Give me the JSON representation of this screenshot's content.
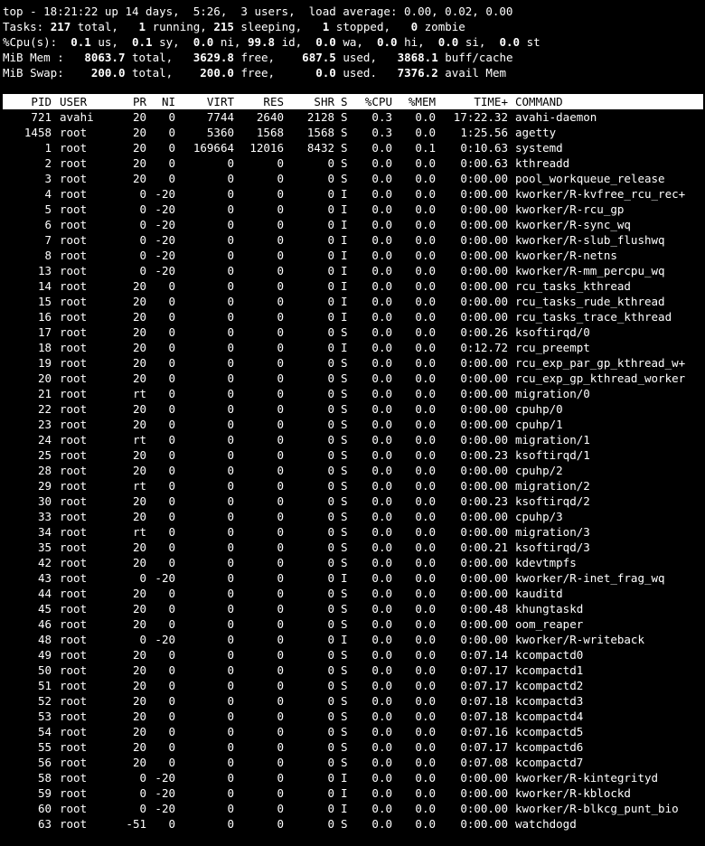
{
  "summary": {
    "line1": {
      "prefix": "top - 18:21:22 up 14 days,  5:26,  3 users,  load average: 0.00, 0.02, 0.00"
    },
    "tasks": [
      {
        "t": "Tasks: ",
        "b": false
      },
      {
        "t": "217",
        "b": true
      },
      {
        "t": " total,   ",
        "b": false
      },
      {
        "t": "1",
        "b": true
      },
      {
        "t": " running, ",
        "b": false
      },
      {
        "t": "215",
        "b": true
      },
      {
        "t": " sleeping,   ",
        "b": false
      },
      {
        "t": "1",
        "b": true
      },
      {
        "t": " stopped,   ",
        "b": false
      },
      {
        "t": "0",
        "b": true
      },
      {
        "t": " zombie",
        "b": false
      }
    ],
    "cpu": [
      {
        "t": "%Cpu(s): ",
        "b": false
      },
      {
        "t": " 0.1",
        "b": true
      },
      {
        "t": " us, ",
        "b": false
      },
      {
        "t": " 0.1",
        "b": true
      },
      {
        "t": " sy, ",
        "b": false
      },
      {
        "t": " 0.0",
        "b": true
      },
      {
        "t": " ni, ",
        "b": false
      },
      {
        "t": "99.8",
        "b": true
      },
      {
        "t": " id, ",
        "b": false
      },
      {
        "t": " 0.0",
        "b": true
      },
      {
        "t": " wa, ",
        "b": false
      },
      {
        "t": " 0.0",
        "b": true
      },
      {
        "t": " hi, ",
        "b": false
      },
      {
        "t": " 0.0",
        "b": true
      },
      {
        "t": " si, ",
        "b": false
      },
      {
        "t": " 0.0",
        "b": true
      },
      {
        "t": " st",
        "b": false
      }
    ],
    "mem": [
      {
        "t": "MiB Mem : ",
        "b": false
      },
      {
        "t": "  8063.7",
        "b": true
      },
      {
        "t": " total, ",
        "b": false
      },
      {
        "t": "  3629.8",
        "b": true
      },
      {
        "t": " free, ",
        "b": false
      },
      {
        "t": "   687.5",
        "b": true
      },
      {
        "t": " used, ",
        "b": false
      },
      {
        "t": "  3868.1",
        "b": true
      },
      {
        "t": " buff/cache",
        "b": false
      }
    ],
    "swap": [
      {
        "t": "MiB Swap: ",
        "b": false
      },
      {
        "t": "   200.0",
        "b": true
      },
      {
        "t": " total, ",
        "b": false
      },
      {
        "t": "   200.0",
        "b": true
      },
      {
        "t": " free, ",
        "b": false
      },
      {
        "t": "     0.0",
        "b": true
      },
      {
        "t": " used. ",
        "b": false
      },
      {
        "t": "  7376.2",
        "b": true
      },
      {
        "t": " avail Mem",
        "b": false
      }
    ]
  },
  "columns": [
    "PID",
    "USER",
    "PR",
    "NI",
    "VIRT",
    "RES",
    "SHR",
    "S",
    "%CPU",
    "%MEM",
    "TIME+",
    "COMMAND"
  ],
  "processes": [
    {
      "pid": "721",
      "user": "avahi",
      "pr": "20",
      "ni": "0",
      "virt": "7744",
      "res": "2640",
      "shr": "2128",
      "s": "S",
      "cpu": "0.3",
      "mem": "0.0",
      "time": "17:22.32",
      "cmd": "avahi-daemon"
    },
    {
      "pid": "1458",
      "user": "root",
      "pr": "20",
      "ni": "0",
      "virt": "5360",
      "res": "1568",
      "shr": "1568",
      "s": "S",
      "cpu": "0.3",
      "mem": "0.0",
      "time": "1:25.56",
      "cmd": "agetty"
    },
    {
      "pid": "1",
      "user": "root",
      "pr": "20",
      "ni": "0",
      "virt": "169664",
      "res": "12016",
      "shr": "8432",
      "s": "S",
      "cpu": "0.0",
      "mem": "0.1",
      "time": "0:10.63",
      "cmd": "systemd"
    },
    {
      "pid": "2",
      "user": "root",
      "pr": "20",
      "ni": "0",
      "virt": "0",
      "res": "0",
      "shr": "0",
      "s": "S",
      "cpu": "0.0",
      "mem": "0.0",
      "time": "0:00.63",
      "cmd": "kthreadd"
    },
    {
      "pid": "3",
      "user": "root",
      "pr": "20",
      "ni": "0",
      "virt": "0",
      "res": "0",
      "shr": "0",
      "s": "S",
      "cpu": "0.0",
      "mem": "0.0",
      "time": "0:00.00",
      "cmd": "pool_workqueue_release"
    },
    {
      "pid": "4",
      "user": "root",
      "pr": "0",
      "ni": "-20",
      "virt": "0",
      "res": "0",
      "shr": "0",
      "s": "I",
      "cpu": "0.0",
      "mem": "0.0",
      "time": "0:00.00",
      "cmd": "kworker/R-kvfree_rcu_rec+"
    },
    {
      "pid": "5",
      "user": "root",
      "pr": "0",
      "ni": "-20",
      "virt": "0",
      "res": "0",
      "shr": "0",
      "s": "I",
      "cpu": "0.0",
      "mem": "0.0",
      "time": "0:00.00",
      "cmd": "kworker/R-rcu_gp"
    },
    {
      "pid": "6",
      "user": "root",
      "pr": "0",
      "ni": "-20",
      "virt": "0",
      "res": "0",
      "shr": "0",
      "s": "I",
      "cpu": "0.0",
      "mem": "0.0",
      "time": "0:00.00",
      "cmd": "kworker/R-sync_wq"
    },
    {
      "pid": "7",
      "user": "root",
      "pr": "0",
      "ni": "-20",
      "virt": "0",
      "res": "0",
      "shr": "0",
      "s": "I",
      "cpu": "0.0",
      "mem": "0.0",
      "time": "0:00.00",
      "cmd": "kworker/R-slub_flushwq"
    },
    {
      "pid": "8",
      "user": "root",
      "pr": "0",
      "ni": "-20",
      "virt": "0",
      "res": "0",
      "shr": "0",
      "s": "I",
      "cpu": "0.0",
      "mem": "0.0",
      "time": "0:00.00",
      "cmd": "kworker/R-netns"
    },
    {
      "pid": "13",
      "user": "root",
      "pr": "0",
      "ni": "-20",
      "virt": "0",
      "res": "0",
      "shr": "0",
      "s": "I",
      "cpu": "0.0",
      "mem": "0.0",
      "time": "0:00.00",
      "cmd": "kworker/R-mm_percpu_wq"
    },
    {
      "pid": "14",
      "user": "root",
      "pr": "20",
      "ni": "0",
      "virt": "0",
      "res": "0",
      "shr": "0",
      "s": "I",
      "cpu": "0.0",
      "mem": "0.0",
      "time": "0:00.00",
      "cmd": "rcu_tasks_kthread"
    },
    {
      "pid": "15",
      "user": "root",
      "pr": "20",
      "ni": "0",
      "virt": "0",
      "res": "0",
      "shr": "0",
      "s": "I",
      "cpu": "0.0",
      "mem": "0.0",
      "time": "0:00.00",
      "cmd": "rcu_tasks_rude_kthread"
    },
    {
      "pid": "16",
      "user": "root",
      "pr": "20",
      "ni": "0",
      "virt": "0",
      "res": "0",
      "shr": "0",
      "s": "I",
      "cpu": "0.0",
      "mem": "0.0",
      "time": "0:00.00",
      "cmd": "rcu_tasks_trace_kthread"
    },
    {
      "pid": "17",
      "user": "root",
      "pr": "20",
      "ni": "0",
      "virt": "0",
      "res": "0",
      "shr": "0",
      "s": "S",
      "cpu": "0.0",
      "mem": "0.0",
      "time": "0:00.26",
      "cmd": "ksoftirqd/0"
    },
    {
      "pid": "18",
      "user": "root",
      "pr": "20",
      "ni": "0",
      "virt": "0",
      "res": "0",
      "shr": "0",
      "s": "I",
      "cpu": "0.0",
      "mem": "0.0",
      "time": "0:12.72",
      "cmd": "rcu_preempt"
    },
    {
      "pid": "19",
      "user": "root",
      "pr": "20",
      "ni": "0",
      "virt": "0",
      "res": "0",
      "shr": "0",
      "s": "S",
      "cpu": "0.0",
      "mem": "0.0",
      "time": "0:00.00",
      "cmd": "rcu_exp_par_gp_kthread_w+"
    },
    {
      "pid": "20",
      "user": "root",
      "pr": "20",
      "ni": "0",
      "virt": "0",
      "res": "0",
      "shr": "0",
      "s": "S",
      "cpu": "0.0",
      "mem": "0.0",
      "time": "0:00.00",
      "cmd": "rcu_exp_gp_kthread_worker"
    },
    {
      "pid": "21",
      "user": "root",
      "pr": "rt",
      "ni": "0",
      "virt": "0",
      "res": "0",
      "shr": "0",
      "s": "S",
      "cpu": "0.0",
      "mem": "0.0",
      "time": "0:00.00",
      "cmd": "migration/0"
    },
    {
      "pid": "22",
      "user": "root",
      "pr": "20",
      "ni": "0",
      "virt": "0",
      "res": "0",
      "shr": "0",
      "s": "S",
      "cpu": "0.0",
      "mem": "0.0",
      "time": "0:00.00",
      "cmd": "cpuhp/0"
    },
    {
      "pid": "23",
      "user": "root",
      "pr": "20",
      "ni": "0",
      "virt": "0",
      "res": "0",
      "shr": "0",
      "s": "S",
      "cpu": "0.0",
      "mem": "0.0",
      "time": "0:00.00",
      "cmd": "cpuhp/1"
    },
    {
      "pid": "24",
      "user": "root",
      "pr": "rt",
      "ni": "0",
      "virt": "0",
      "res": "0",
      "shr": "0",
      "s": "S",
      "cpu": "0.0",
      "mem": "0.0",
      "time": "0:00.00",
      "cmd": "migration/1"
    },
    {
      "pid": "25",
      "user": "root",
      "pr": "20",
      "ni": "0",
      "virt": "0",
      "res": "0",
      "shr": "0",
      "s": "S",
      "cpu": "0.0",
      "mem": "0.0",
      "time": "0:00.23",
      "cmd": "ksoftirqd/1"
    },
    {
      "pid": "28",
      "user": "root",
      "pr": "20",
      "ni": "0",
      "virt": "0",
      "res": "0",
      "shr": "0",
      "s": "S",
      "cpu": "0.0",
      "mem": "0.0",
      "time": "0:00.00",
      "cmd": "cpuhp/2"
    },
    {
      "pid": "29",
      "user": "root",
      "pr": "rt",
      "ni": "0",
      "virt": "0",
      "res": "0",
      "shr": "0",
      "s": "S",
      "cpu": "0.0",
      "mem": "0.0",
      "time": "0:00.00",
      "cmd": "migration/2"
    },
    {
      "pid": "30",
      "user": "root",
      "pr": "20",
      "ni": "0",
      "virt": "0",
      "res": "0",
      "shr": "0",
      "s": "S",
      "cpu": "0.0",
      "mem": "0.0",
      "time": "0:00.23",
      "cmd": "ksoftirqd/2"
    },
    {
      "pid": "33",
      "user": "root",
      "pr": "20",
      "ni": "0",
      "virt": "0",
      "res": "0",
      "shr": "0",
      "s": "S",
      "cpu": "0.0",
      "mem": "0.0",
      "time": "0:00.00",
      "cmd": "cpuhp/3"
    },
    {
      "pid": "34",
      "user": "root",
      "pr": "rt",
      "ni": "0",
      "virt": "0",
      "res": "0",
      "shr": "0",
      "s": "S",
      "cpu": "0.0",
      "mem": "0.0",
      "time": "0:00.00",
      "cmd": "migration/3"
    },
    {
      "pid": "35",
      "user": "root",
      "pr": "20",
      "ni": "0",
      "virt": "0",
      "res": "0",
      "shr": "0",
      "s": "S",
      "cpu": "0.0",
      "mem": "0.0",
      "time": "0:00.21",
      "cmd": "ksoftirqd/3"
    },
    {
      "pid": "42",
      "user": "root",
      "pr": "20",
      "ni": "0",
      "virt": "0",
      "res": "0",
      "shr": "0",
      "s": "S",
      "cpu": "0.0",
      "mem": "0.0",
      "time": "0:00.00",
      "cmd": "kdevtmpfs"
    },
    {
      "pid": "43",
      "user": "root",
      "pr": "0",
      "ni": "-20",
      "virt": "0",
      "res": "0",
      "shr": "0",
      "s": "I",
      "cpu": "0.0",
      "mem": "0.0",
      "time": "0:00.00",
      "cmd": "kworker/R-inet_frag_wq"
    },
    {
      "pid": "44",
      "user": "root",
      "pr": "20",
      "ni": "0",
      "virt": "0",
      "res": "0",
      "shr": "0",
      "s": "S",
      "cpu": "0.0",
      "mem": "0.0",
      "time": "0:00.00",
      "cmd": "kauditd"
    },
    {
      "pid": "45",
      "user": "root",
      "pr": "20",
      "ni": "0",
      "virt": "0",
      "res": "0",
      "shr": "0",
      "s": "S",
      "cpu": "0.0",
      "mem": "0.0",
      "time": "0:00.48",
      "cmd": "khungtaskd"
    },
    {
      "pid": "46",
      "user": "root",
      "pr": "20",
      "ni": "0",
      "virt": "0",
      "res": "0",
      "shr": "0",
      "s": "S",
      "cpu": "0.0",
      "mem": "0.0",
      "time": "0:00.00",
      "cmd": "oom_reaper"
    },
    {
      "pid": "48",
      "user": "root",
      "pr": "0",
      "ni": "-20",
      "virt": "0",
      "res": "0",
      "shr": "0",
      "s": "I",
      "cpu": "0.0",
      "mem": "0.0",
      "time": "0:00.00",
      "cmd": "kworker/R-writeback"
    },
    {
      "pid": "49",
      "user": "root",
      "pr": "20",
      "ni": "0",
      "virt": "0",
      "res": "0",
      "shr": "0",
      "s": "S",
      "cpu": "0.0",
      "mem": "0.0",
      "time": "0:07.14",
      "cmd": "kcompactd0"
    },
    {
      "pid": "50",
      "user": "root",
      "pr": "20",
      "ni": "0",
      "virt": "0",
      "res": "0",
      "shr": "0",
      "s": "S",
      "cpu": "0.0",
      "mem": "0.0",
      "time": "0:07.17",
      "cmd": "kcompactd1"
    },
    {
      "pid": "51",
      "user": "root",
      "pr": "20",
      "ni": "0",
      "virt": "0",
      "res": "0",
      "shr": "0",
      "s": "S",
      "cpu": "0.0",
      "mem": "0.0",
      "time": "0:07.17",
      "cmd": "kcompactd2"
    },
    {
      "pid": "52",
      "user": "root",
      "pr": "20",
      "ni": "0",
      "virt": "0",
      "res": "0",
      "shr": "0",
      "s": "S",
      "cpu": "0.0",
      "mem": "0.0",
      "time": "0:07.18",
      "cmd": "kcompactd3"
    },
    {
      "pid": "53",
      "user": "root",
      "pr": "20",
      "ni": "0",
      "virt": "0",
      "res": "0",
      "shr": "0",
      "s": "S",
      "cpu": "0.0",
      "mem": "0.0",
      "time": "0:07.18",
      "cmd": "kcompactd4"
    },
    {
      "pid": "54",
      "user": "root",
      "pr": "20",
      "ni": "0",
      "virt": "0",
      "res": "0",
      "shr": "0",
      "s": "S",
      "cpu": "0.0",
      "mem": "0.0",
      "time": "0:07.16",
      "cmd": "kcompactd5"
    },
    {
      "pid": "55",
      "user": "root",
      "pr": "20",
      "ni": "0",
      "virt": "0",
      "res": "0",
      "shr": "0",
      "s": "S",
      "cpu": "0.0",
      "mem": "0.0",
      "time": "0:07.17",
      "cmd": "kcompactd6"
    },
    {
      "pid": "56",
      "user": "root",
      "pr": "20",
      "ni": "0",
      "virt": "0",
      "res": "0",
      "shr": "0",
      "s": "S",
      "cpu": "0.0",
      "mem": "0.0",
      "time": "0:07.08",
      "cmd": "kcompactd7"
    },
    {
      "pid": "58",
      "user": "root",
      "pr": "0",
      "ni": "-20",
      "virt": "0",
      "res": "0",
      "shr": "0",
      "s": "I",
      "cpu": "0.0",
      "mem": "0.0",
      "time": "0:00.00",
      "cmd": "kworker/R-kintegrityd"
    },
    {
      "pid": "59",
      "user": "root",
      "pr": "0",
      "ni": "-20",
      "virt": "0",
      "res": "0",
      "shr": "0",
      "s": "I",
      "cpu": "0.0",
      "mem": "0.0",
      "time": "0:00.00",
      "cmd": "kworker/R-kblockd"
    },
    {
      "pid": "60",
      "user": "root",
      "pr": "0",
      "ni": "-20",
      "virt": "0",
      "res": "0",
      "shr": "0",
      "s": "I",
      "cpu": "0.0",
      "mem": "0.0",
      "time": "0:00.00",
      "cmd": "kworker/R-blkcg_punt_bio"
    },
    {
      "pid": "63",
      "user": "root",
      "pr": "-51",
      "ni": "0",
      "virt": "0",
      "res": "0",
      "shr": "0",
      "s": "S",
      "cpu": "0.0",
      "mem": "0.0",
      "time": "0:00.00",
      "cmd": "watchdogd"
    }
  ],
  "colors": {
    "background": "#000000",
    "text": "#ffffff",
    "header_bg": "#ffffff",
    "header_text": "#000000"
  }
}
